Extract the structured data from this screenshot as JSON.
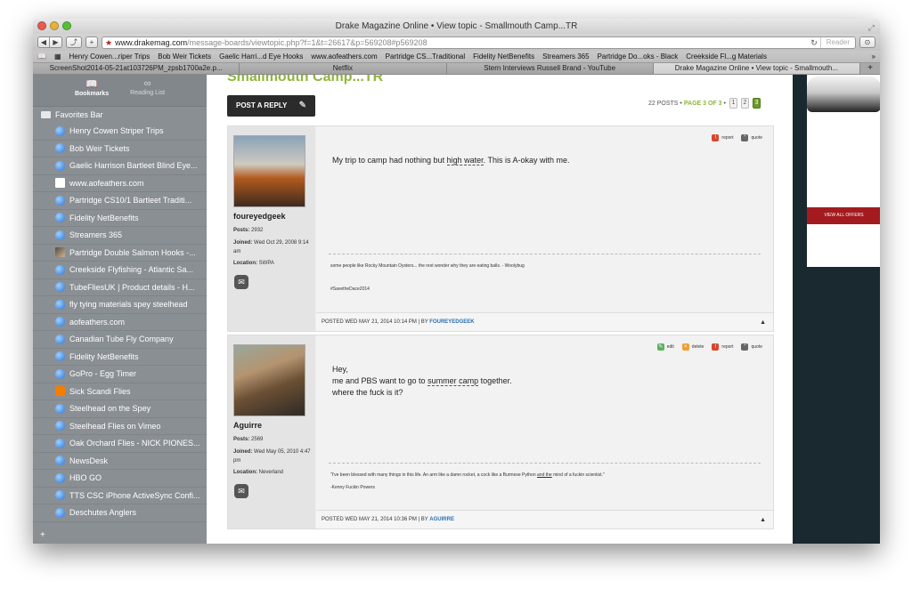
{
  "window": {
    "title": "Drake Magazine Online • View topic - Smallmouth Camp...TR"
  },
  "toolbar": {
    "url_domain": "www.drakemag.com",
    "url_path": "/message-boards/viewtopic.php?f=1&t=26617&p=569208#p569208",
    "reader_label": "Reader",
    "back": "◀",
    "forward": "▶",
    "share": "⤴",
    "add": "+",
    "reload": "↻",
    "downloads": "⊙"
  },
  "bookmarks_bar": {
    "items": [
      "Henry Cowen...riper Trips",
      "Bob Weir Tickets",
      "Gaelic Harri...d Eye Hooks",
      "www.aofeathers.com",
      "Partridge CS...Traditional",
      "Fidelity NetBenefits",
      "Streamers 365",
      "Partridge Do...oks - Black",
      "Creekside Fl...g Materials"
    ],
    "more": "»"
  },
  "tabs": [
    {
      "label": "ScreenShot2014-05-21at103726PM_zpsb1700a2e.p...",
      "active": false
    },
    {
      "label": "Netflix",
      "active": false
    },
    {
      "label": "Stern Interviews Russell Brand - YouTube",
      "active": false
    },
    {
      "label": "Drake Magazine Online • View topic - Smallmouth...",
      "active": true
    }
  ],
  "sidebar": {
    "bookmarks_label": "Bookmarks",
    "reading_list_label": "Reading List",
    "favorites_label": "Favorites Bar",
    "items": [
      {
        "label": "Henry Cowen Striper Trips",
        "icon": "globe-icon"
      },
      {
        "label": "Bob Weir Tickets",
        "icon": "globe-icon"
      },
      {
        "label": "Gaelic Harrison Bartleet Blind Eye...",
        "icon": "globe-icon"
      },
      {
        "label": "www.aofeathers.com",
        "icon": "blank-page-icon"
      },
      {
        "label": "Partridge CS10/1 Bartleet Traditi...",
        "icon": "globe-icon"
      },
      {
        "label": "Fidelity NetBenefits",
        "icon": "globe-icon"
      },
      {
        "label": "Streamers 365",
        "icon": "globe-icon"
      },
      {
        "label": "Partridge Double Salmon Hooks -...",
        "icon": "photo-favicon-icon"
      },
      {
        "label": "Creekside Flyfishing - Atlantic Sa...",
        "icon": "globe-icon"
      },
      {
        "label": "TubeFliesUK | Product details - H...",
        "icon": "globe-icon"
      },
      {
        "label": "fly tying materials spey steelhead",
        "icon": "globe-icon"
      },
      {
        "label": "aofeathers.com",
        "icon": "globe-icon"
      },
      {
        "label": "Canadian Tube Fly Company",
        "icon": "globe-icon"
      },
      {
        "label": "Fidelity NetBenefits",
        "icon": "globe-icon"
      },
      {
        "label": "GoPro - Egg Timer",
        "icon": "globe-icon"
      },
      {
        "label": "Sick Scandi Flies",
        "icon": "blogger-icon"
      },
      {
        "label": "Steelhead on the Spey",
        "icon": "globe-icon"
      },
      {
        "label": "Steelhead Flies on Vimeo",
        "icon": "globe-icon"
      },
      {
        "label": "Oak Orchard Flies - NICK PIONES...",
        "icon": "globe-icon"
      },
      {
        "label": "NewsDesk",
        "icon": "globe-icon"
      },
      {
        "label": "HBO GO",
        "icon": "globe-icon"
      },
      {
        "label": "TTS CSC iPhone ActiveSync Confi...",
        "icon": "globe-icon"
      },
      {
        "label": "Deschutes Anglers",
        "icon": "globe-icon"
      }
    ],
    "add": "+"
  },
  "topic": {
    "title": "Smallmouth Camp...TR",
    "post_reply": "POST A REPLY",
    "posts_count": "22 POSTS •",
    "page_text": "PAGE 3 OF 3",
    "page_sep": "•",
    "pages": [
      "1",
      "2",
      "3"
    ],
    "current_page": "3"
  },
  "posts": [
    {
      "username": "foureyedgeek",
      "posts_label": "Posts:",
      "posts": "2932",
      "joined_label": "Joined:",
      "joined": "Wed Oct 29, 2008 9:14 am",
      "location_label": "Location:",
      "location": "SWPA",
      "actions": {
        "report": "report",
        "quote": "quote"
      },
      "text_before": "My trip to camp had nothing but ",
      "text_link": "high water",
      "text_after": ". This is A-okay with me.",
      "sig1": "some people like Rocky Mountain Oysters... the rest wonder why they are eating balls. - Woolybug",
      "sig2": "#SavetheDace2014",
      "footer_prefix": "POSTED WED MAY 21, 2014 10:14 PM | BY",
      "footer_author": "FOUREYEDGEEK"
    },
    {
      "username": "Aguirre",
      "posts_label": "Posts:",
      "posts": "2569",
      "joined_label": "Joined:",
      "joined": "Wed May 05, 2010 4:47 pm",
      "location_label": "Location:",
      "location": "Neverland",
      "actions": {
        "edit": "edit",
        "delete": "delete",
        "report": "report",
        "quote": "quote"
      },
      "line1": "Hey,",
      "line2_before": "me and PBS want to go to ",
      "line2_link": "summer camp",
      "line2_after": " together.",
      "line3": "where the fuck is it?",
      "sig1_before": "\"I've been blessed with many things in this life. An arm like a damn rocket, a cock like a Burmese Python ",
      "sig1_link": "and the",
      "sig1_after": " mind of a fuckin scientist.\"",
      "sig2": "-Kenny Fuckin Powers",
      "footer_prefix": "POSTED WED MAY 21, 2014 10:36 PM | BY",
      "footer_author": "AGUIRRE"
    }
  ],
  "ad": {
    "offers_label": "VIEW ALL OFFERS"
  }
}
